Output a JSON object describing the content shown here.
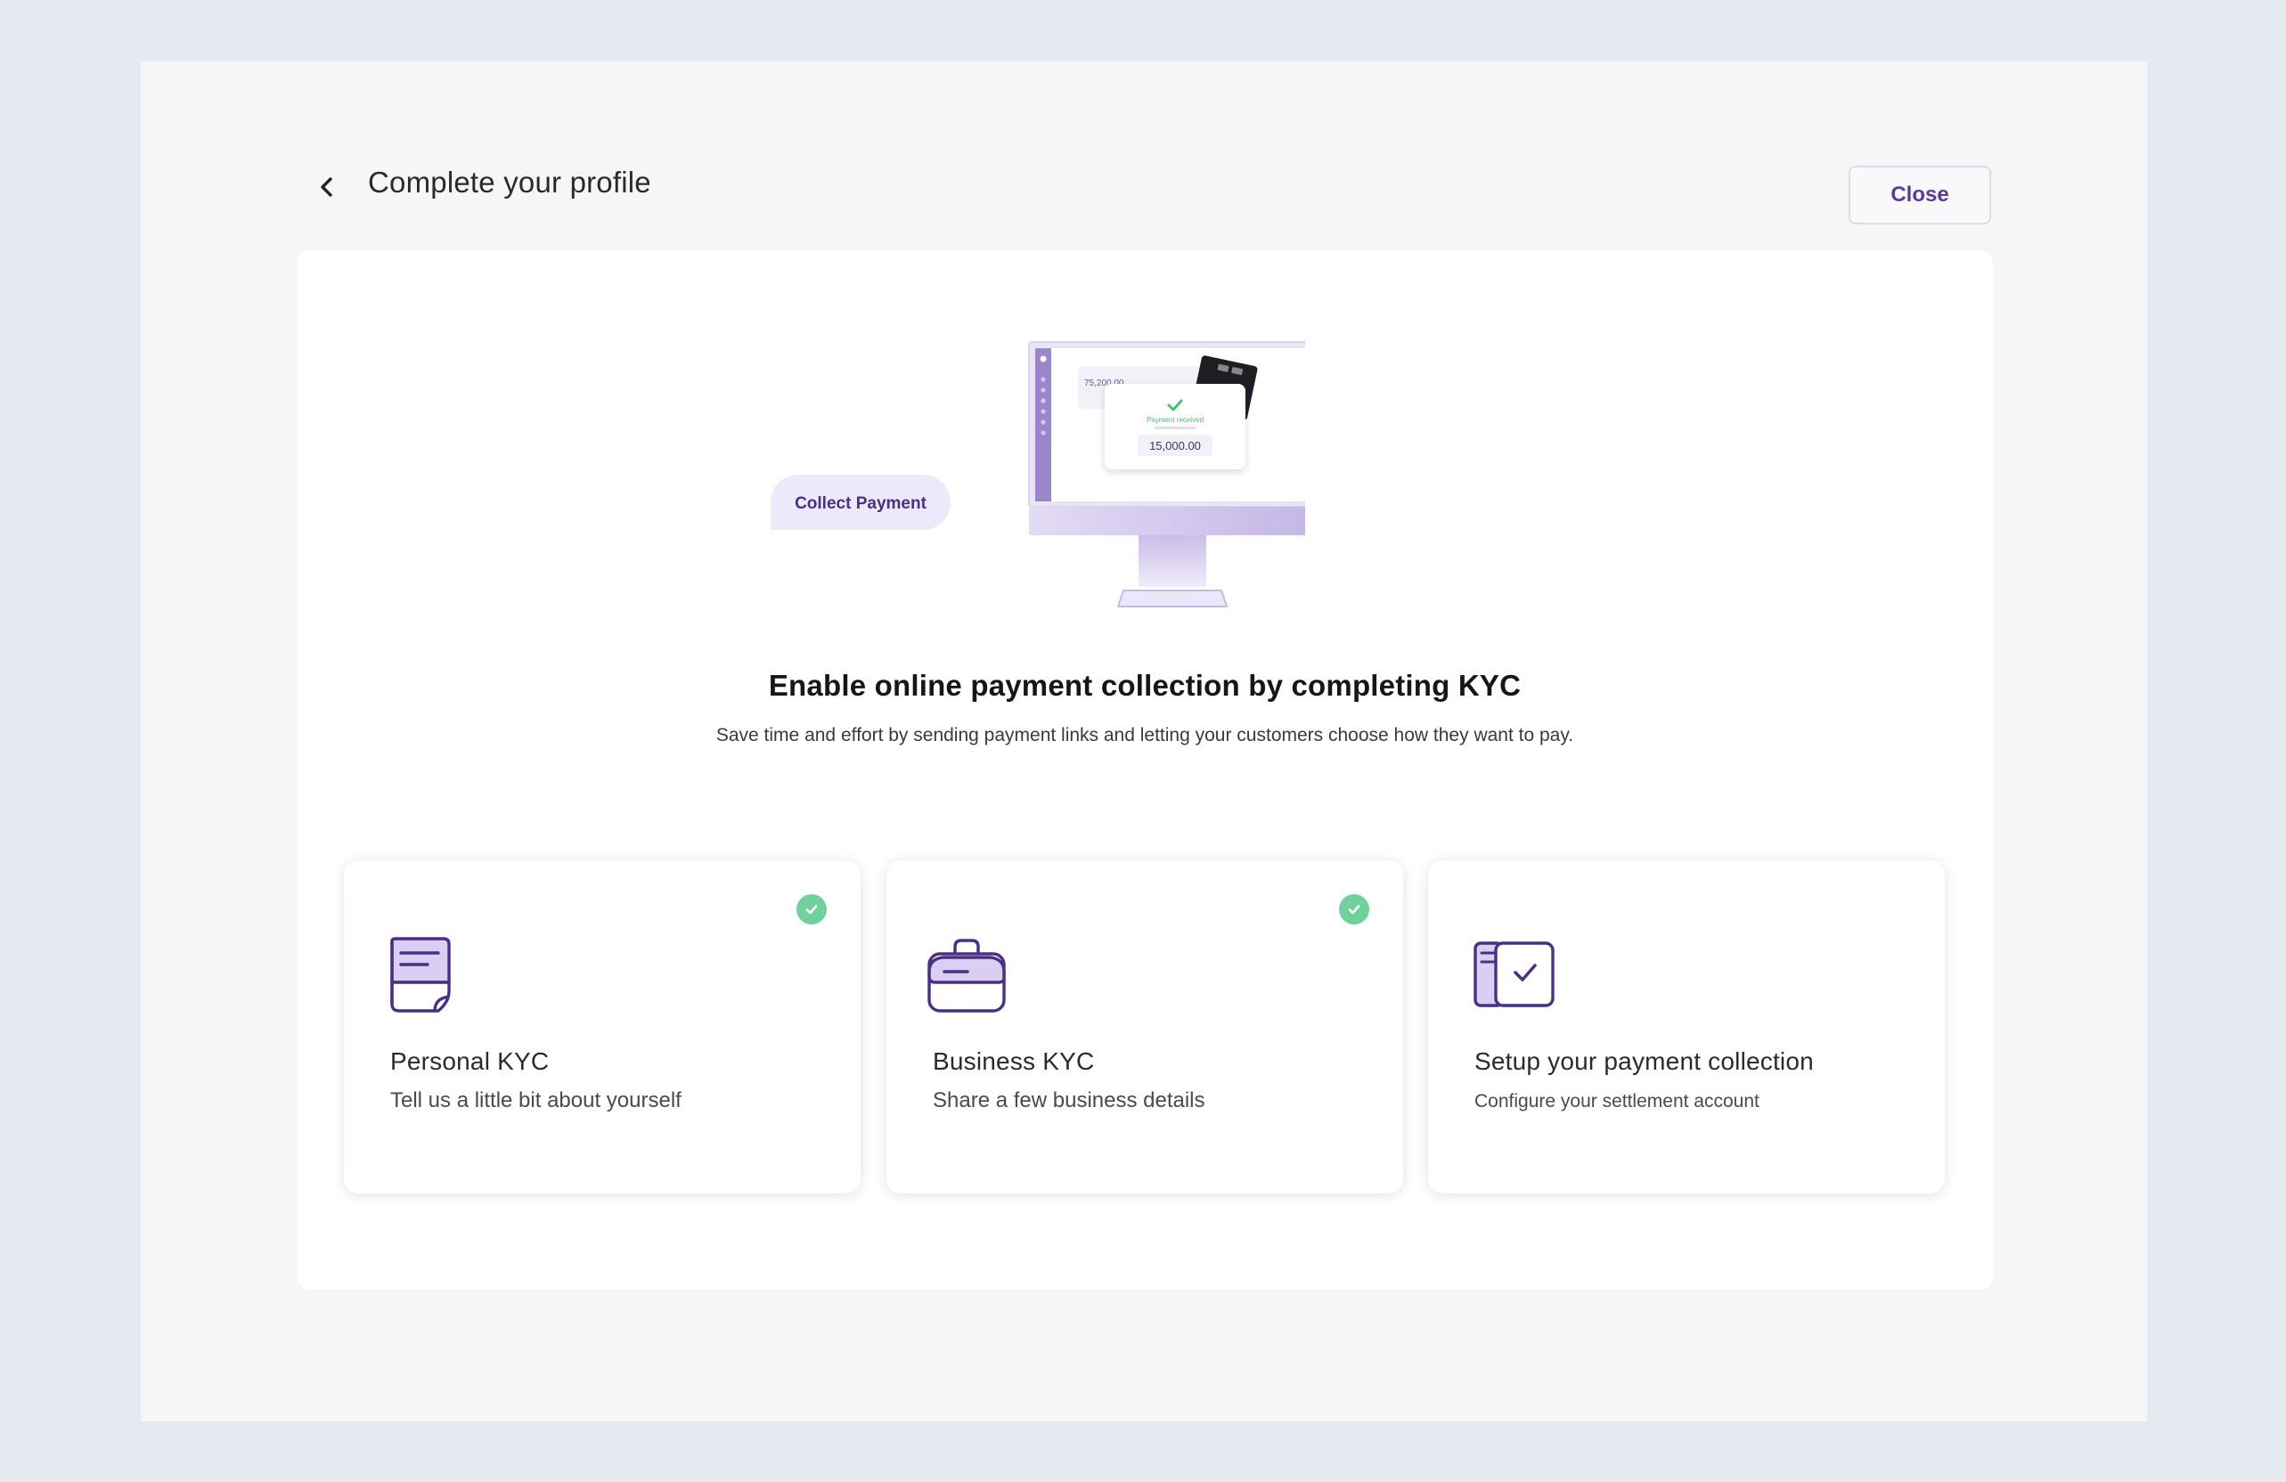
{
  "header": {
    "back_icon": "chevron-left-icon",
    "title": "Complete your profile",
    "close_label": "Close"
  },
  "hero": {
    "collect_payment_label": "Collect Payment",
    "screen_amount_top": "75,200.00",
    "payment_status": "Payment received",
    "payment_amount": "15,000.00",
    "headline": "Enable online payment collection by completing KYC",
    "subline": "Save time and effort by sending payment links and letting your customers choose how they want to pay."
  },
  "steps": [
    {
      "icon": "document-icon",
      "title": "Personal KYC",
      "description": "Tell us a little bit about yourself",
      "completed": true
    },
    {
      "icon": "briefcase-icon",
      "title": "Business KYC",
      "description": "Share a few business details",
      "completed": true
    },
    {
      "icon": "bank-check-icon",
      "title": "Setup your payment collection",
      "description": "Configure your settlement account",
      "completed": false
    }
  ],
  "colors": {
    "accent": "#5b3a9b",
    "success": "#6fd29a",
    "lavender": "#d9cff2",
    "page_bg": "#e5e9f1"
  }
}
